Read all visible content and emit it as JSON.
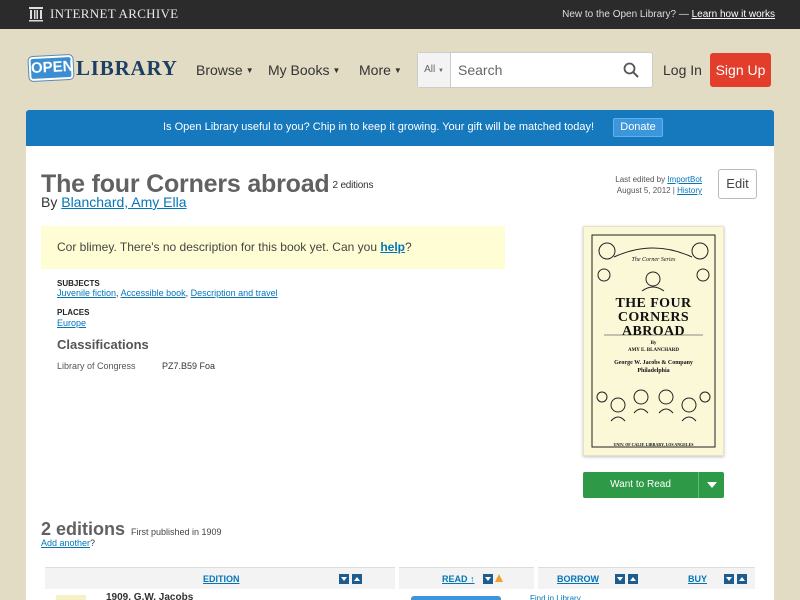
{
  "ia_bar": {
    "logo_text": "INTERNET ARCHIVE",
    "new_text": "New to the Open Library? — ",
    "learn_link": "Learn how it works"
  },
  "header": {
    "logo_badge": "OPEN",
    "logo_text": "LIBRARY",
    "nav": [
      {
        "label": "Browse"
      },
      {
        "label": "My Books"
      },
      {
        "label": "More"
      }
    ],
    "search": {
      "scope": "All",
      "placeholder": "Search"
    },
    "login_label": "Log In",
    "signup_label": "Sign Up"
  },
  "banner": {
    "text": "Is Open Library useful to you? Chip in to keep it growing. Your gift will be matched today!",
    "button_label": "Donate"
  },
  "book": {
    "title": "The four Corners abroad",
    "editions_count": "2 editions",
    "by_label": "By ",
    "author": "Blanchard, Amy Ella",
    "last_edited_prefix": "Last edited by ",
    "last_edited_user": "ImportBot",
    "last_edited_date": "August 5, 2012 | ",
    "history_link": "History",
    "edit_label": "Edit",
    "no_description_text": "Cor blimey. There's no description for this book yet. Can you ",
    "help_link": "help",
    "no_description_end": "?",
    "subjects_label": "SUBJECTS",
    "subjects": [
      "Juvenile fiction",
      "Accessible book",
      "Description and travel"
    ],
    "places_label": "PLACES",
    "places": [
      "Europe"
    ],
    "classifications_label": "Classifications",
    "lc_label": "Library of Congress",
    "lc_value": "PZ7.B59 Foa",
    "want_label": "Want to Read"
  },
  "cover": {
    "series": "The Corner Series",
    "title_lines": [
      "THE FOUR",
      "CORNERS",
      "ABROAD"
    ],
    "by": "By",
    "author": "AMY E. BLANCHARD",
    "publisher": "George W. Jacobs & Company",
    "city": "Philadelphia",
    "stamp": "UNIV. OF CALIF. LIBRARY, LOS ANGELES"
  },
  "editions": {
    "heading": "2 editions",
    "first_published": "First published in 1909",
    "add_another": "Add another",
    "add_another_end": "?",
    "columns": [
      {
        "label": "EDITION"
      },
      {
        "label": "READ ↑"
      },
      {
        "label": "BORROW"
      },
      {
        "label": "BUY"
      }
    ],
    "first_row_title": "1909, G.W. Jacobs",
    "first_row_link": "Find in Library"
  },
  "colors": {
    "ia_bar": "#2b2b2b",
    "page_bg": "#e2dcc5",
    "banner": "#1679be",
    "signup": "#e23e2b",
    "want_to_read": "#2e9a47",
    "link": "#0376b8"
  }
}
